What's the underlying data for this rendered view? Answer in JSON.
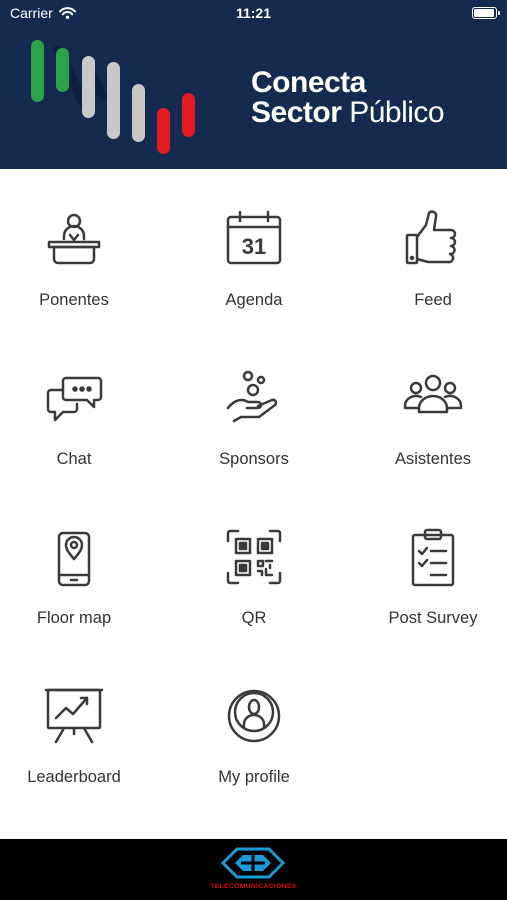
{
  "status_bar": {
    "carrier": "Carrier",
    "time": "11:21",
    "battery_level": 1.0
  },
  "header": {
    "title_line1": "Conecta",
    "title_line2_bold": "Sector",
    "title_line2_regular": "Público"
  },
  "menu": {
    "items": [
      {
        "label": "Ponentes",
        "icon": "speaker-podium-icon"
      },
      {
        "label": "Agenda",
        "icon": "calendar-icon",
        "icon_text": "31"
      },
      {
        "label": "Feed",
        "icon": "thumbs-up-icon"
      },
      {
        "label": "Chat",
        "icon": "chat-bubbles-icon"
      },
      {
        "label": "Sponsors",
        "icon": "hand-coins-icon"
      },
      {
        "label": "Asistentes",
        "icon": "people-group-icon"
      },
      {
        "label": "Floor map",
        "icon": "phone-location-icon"
      },
      {
        "label": "QR",
        "icon": "qr-code-icon"
      },
      {
        "label": "Post Survey",
        "icon": "clipboard-checklist-icon"
      },
      {
        "label": "Leaderboard",
        "icon": "presentation-chart-icon"
      },
      {
        "label": "My profile",
        "icon": "user-circle-icon"
      }
    ]
  },
  "footer": {
    "brand_text": "TELECOMUNICACIONES"
  },
  "colors": {
    "navy": "#142a4f",
    "green": "#2ca24a",
    "gray": "#c8c8c8",
    "red": "#e31b23",
    "icon": "#3a3a3a"
  }
}
